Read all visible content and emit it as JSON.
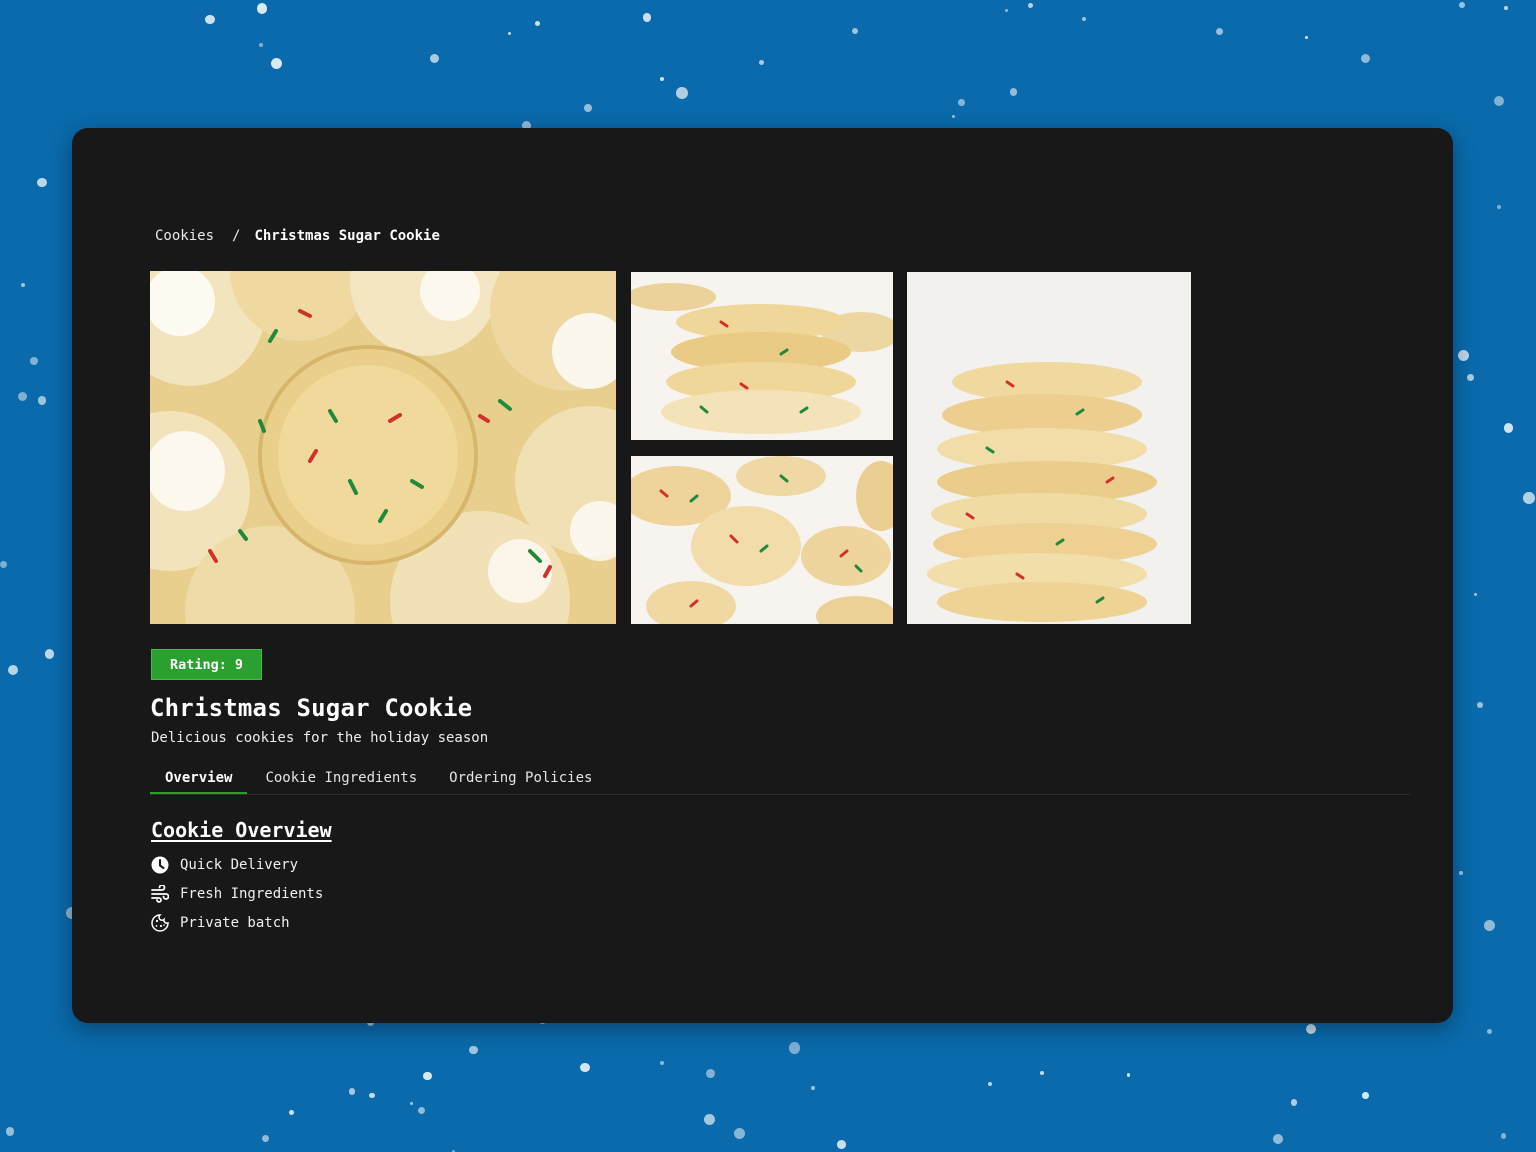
{
  "colors": {
    "page_background": "#0a6aab",
    "card_background": "#181818",
    "accent_green": "#2aa12f"
  },
  "breadcrumb": {
    "parent": "Cookies",
    "separator": "/",
    "current": "Christmas Sugar Cookie"
  },
  "gallery": {
    "images": [
      {
        "subject": "crinkle sugar cookies with red and green sprinkles, close-up"
      },
      {
        "subject": "stack of broken sprinkle cookies"
      },
      {
        "subject": "sprinkle cookies spread on white surface"
      },
      {
        "subject": "tall stack of sprinkle sugar cookies"
      }
    ]
  },
  "rating": {
    "label": "Rating:",
    "value": "9"
  },
  "product": {
    "title": "Christmas Sugar Cookie",
    "subtitle": "Delicious cookies for the holiday season"
  },
  "tabs": [
    {
      "label": "Overview",
      "active": true
    },
    {
      "label": "Cookie Ingredients",
      "active": false
    },
    {
      "label": "Ordering Policies",
      "active": false
    }
  ],
  "overview": {
    "heading": "Cookie Overview",
    "features": [
      {
        "icon": "clock-icon",
        "label": "Quick Delivery"
      },
      {
        "icon": "wind-icon",
        "label": "Fresh Ingredients"
      },
      {
        "icon": "cookie-icon",
        "label": "Private batch"
      }
    ]
  }
}
